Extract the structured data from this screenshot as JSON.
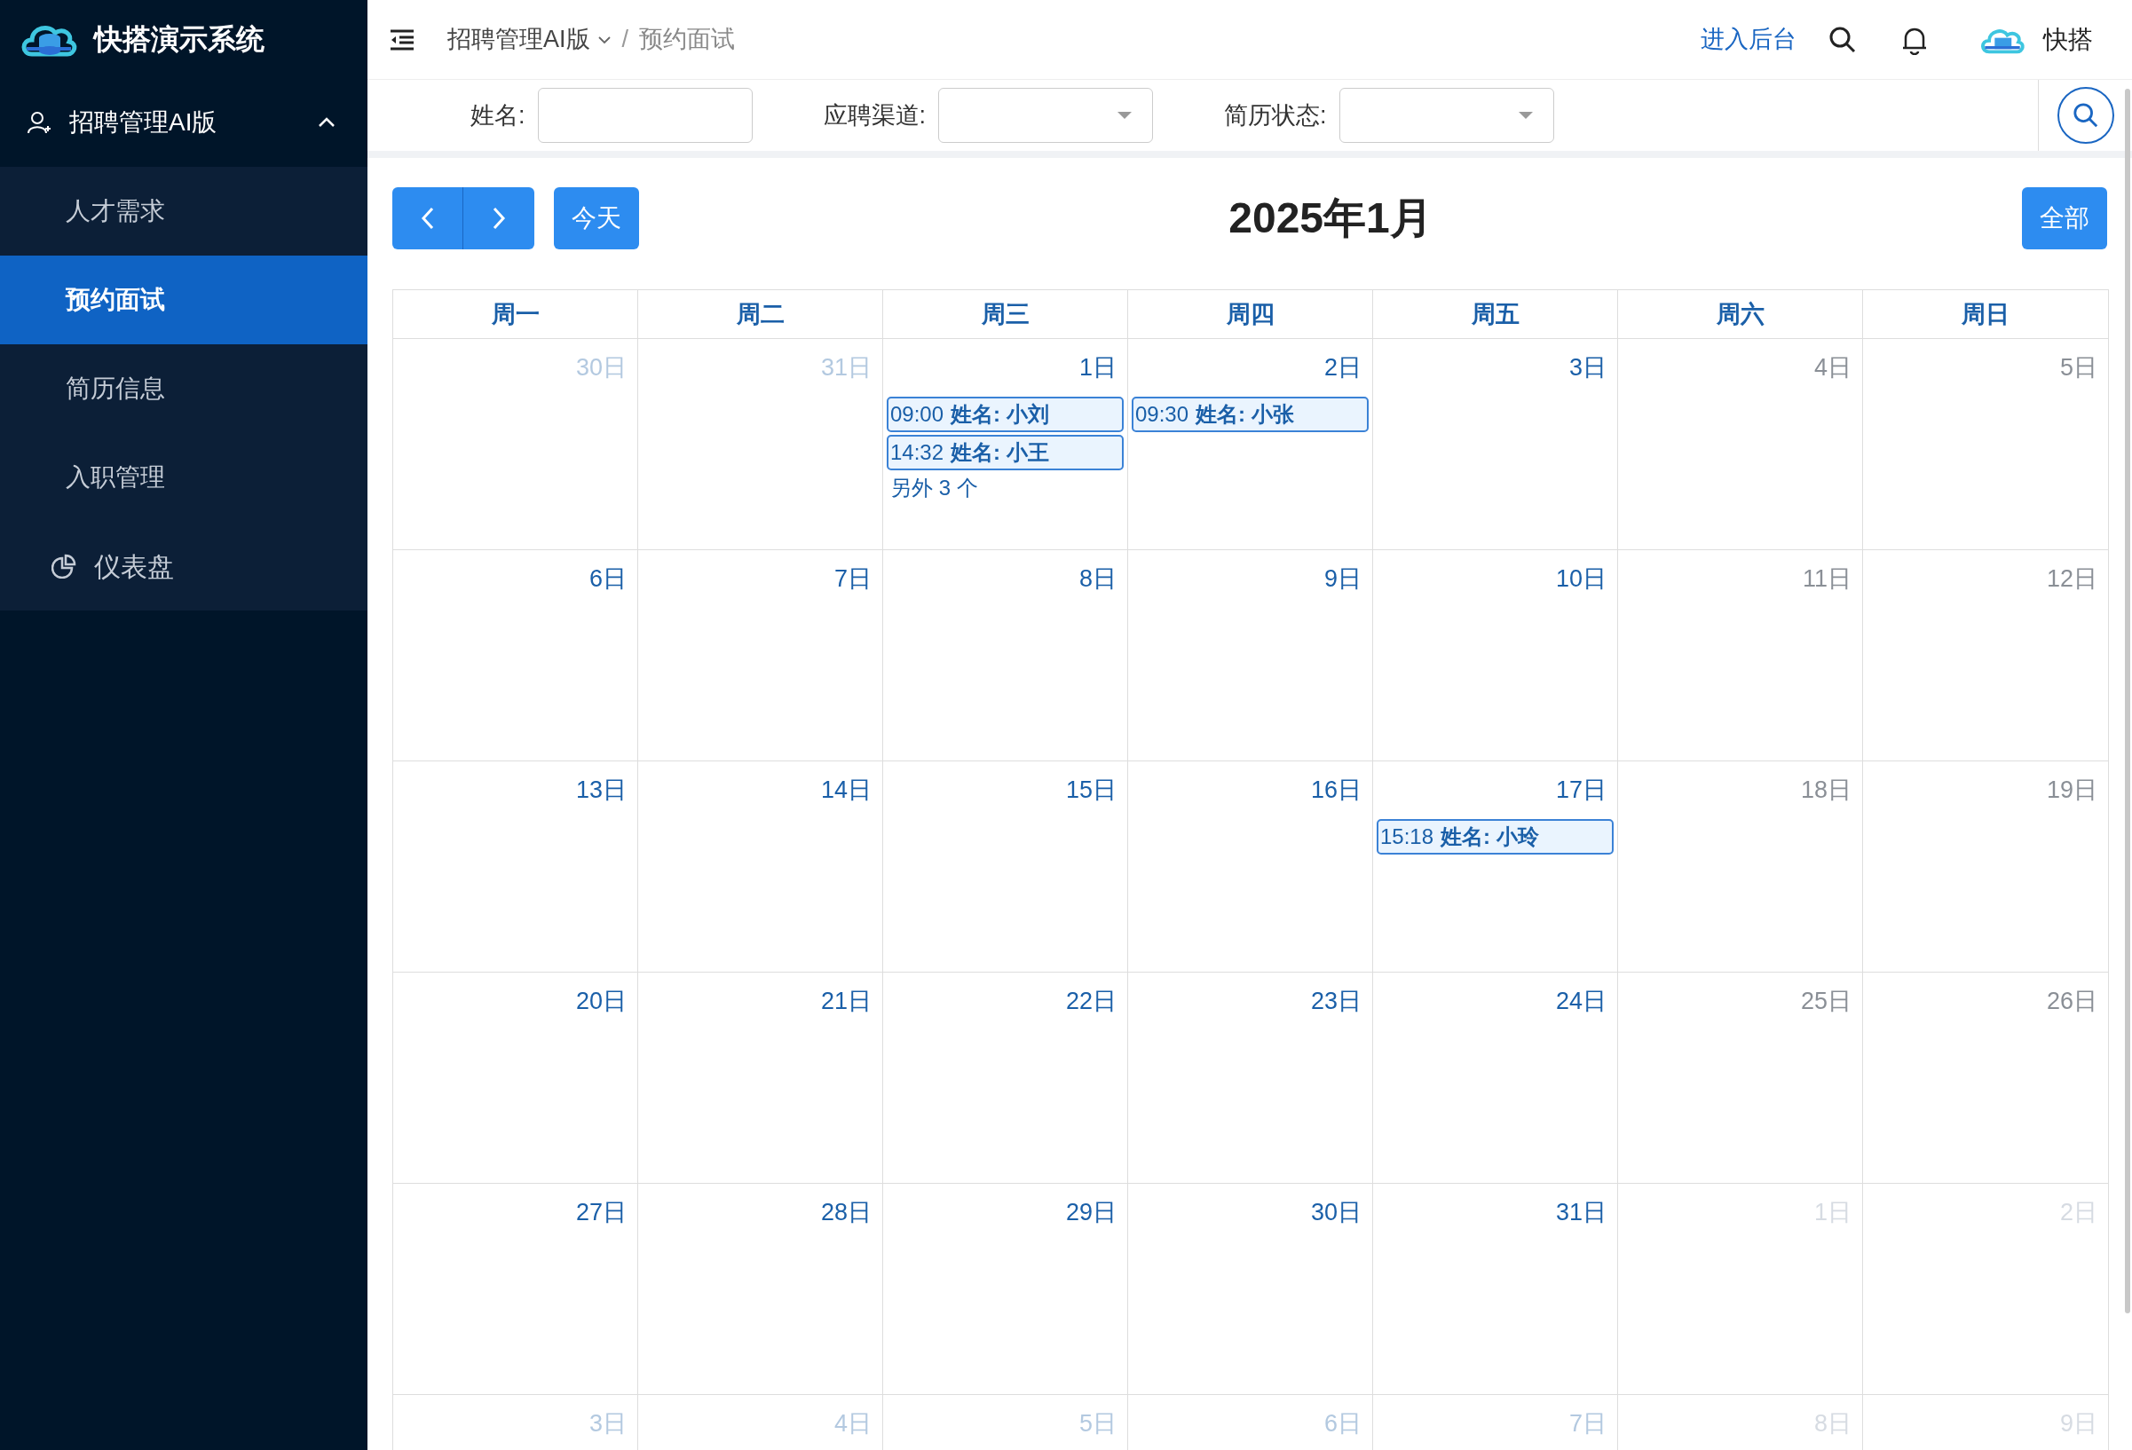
{
  "brand": {
    "title": "快搭演示系统"
  },
  "sidebar": {
    "items": [
      {
        "kind": "group",
        "label": "招聘管理AI版",
        "expanded": true,
        "children": [
          {
            "label": "人才需求",
            "selected": false
          },
          {
            "label": "预约面试",
            "selected": true
          },
          {
            "label": "简历信息",
            "selected": false
          },
          {
            "label": "入职管理",
            "selected": false
          }
        ]
      },
      {
        "kind": "link",
        "label": "仪表盘"
      }
    ]
  },
  "header": {
    "breadcrumb_separator": "/",
    "breadcrumb": [
      {
        "label": "招聘管理AI版",
        "dropdown": true
      },
      {
        "label": "预约面试",
        "dropdown": false
      }
    ],
    "admin_link": "进入后台",
    "user": "快搭"
  },
  "filters": [
    {
      "label": "姓名:",
      "kind": "text"
    },
    {
      "label": "应聘渠道:",
      "kind": "select"
    },
    {
      "label": "简历状态:",
      "kind": "select"
    }
  ],
  "calendar": {
    "today_button": "今天",
    "title": "2025年1月",
    "all_button": "全部",
    "weekdays": [
      "周一",
      "周二",
      "周三",
      "周四",
      "周五",
      "周六",
      "周日"
    ],
    "weeks": [
      [
        {
          "label": "30日",
          "other_month": true
        },
        {
          "label": "31日",
          "other_month": true
        },
        {
          "label": "1日",
          "other_month": false,
          "events": [
            {
              "time": "09:00",
              "title": "姓名: 小刘"
            },
            {
              "time": "14:32",
              "title": "姓名: 小王"
            }
          ],
          "more": "另外 3 个"
        },
        {
          "label": "2日",
          "other_month": false,
          "events": [
            {
              "time": "09:30",
              "title": "姓名: 小张"
            }
          ]
        },
        {
          "label": "3日",
          "other_month": false
        },
        {
          "label": "4日",
          "other_month": false
        },
        {
          "label": "5日",
          "other_month": false
        }
      ],
      [
        {
          "label": "6日",
          "other_month": false
        },
        {
          "label": "7日",
          "other_month": false
        },
        {
          "label": "8日",
          "other_month": false
        },
        {
          "label": "9日",
          "other_month": false
        },
        {
          "label": "10日",
          "other_month": false
        },
        {
          "label": "11日",
          "other_month": false
        },
        {
          "label": "12日",
          "other_month": false
        }
      ],
      [
        {
          "label": "13日",
          "other_month": false
        },
        {
          "label": "14日",
          "other_month": false
        },
        {
          "label": "15日",
          "other_month": false
        },
        {
          "label": "16日",
          "other_month": false
        },
        {
          "label": "17日",
          "other_month": false,
          "events": [
            {
              "time": "15:18",
              "title": "姓名: 小玲"
            }
          ]
        },
        {
          "label": "18日",
          "other_month": false
        },
        {
          "label": "19日",
          "other_month": false
        }
      ],
      [
        {
          "label": "20日",
          "other_month": false
        },
        {
          "label": "21日",
          "other_month": false
        },
        {
          "label": "22日",
          "other_month": false
        },
        {
          "label": "23日",
          "other_month": false
        },
        {
          "label": "24日",
          "other_month": false
        },
        {
          "label": "25日",
          "other_month": false
        },
        {
          "label": "26日",
          "other_month": false
        }
      ],
      [
        {
          "label": "27日",
          "other_month": false
        },
        {
          "label": "28日",
          "other_month": false
        },
        {
          "label": "29日",
          "other_month": false
        },
        {
          "label": "30日",
          "other_month": false
        },
        {
          "label": "31日",
          "other_month": false
        },
        {
          "label": "1日",
          "other_month": true
        },
        {
          "label": "2日",
          "other_month": true
        }
      ],
      [
        {
          "label": "3日",
          "other_month": true
        },
        {
          "label": "4日",
          "other_month": true
        },
        {
          "label": "5日",
          "other_month": true
        },
        {
          "label": "6日",
          "other_month": true
        },
        {
          "label": "7日",
          "other_month": true
        },
        {
          "label": "8日",
          "other_month": true
        },
        {
          "label": "9日",
          "other_month": true
        }
      ]
    ]
  }
}
